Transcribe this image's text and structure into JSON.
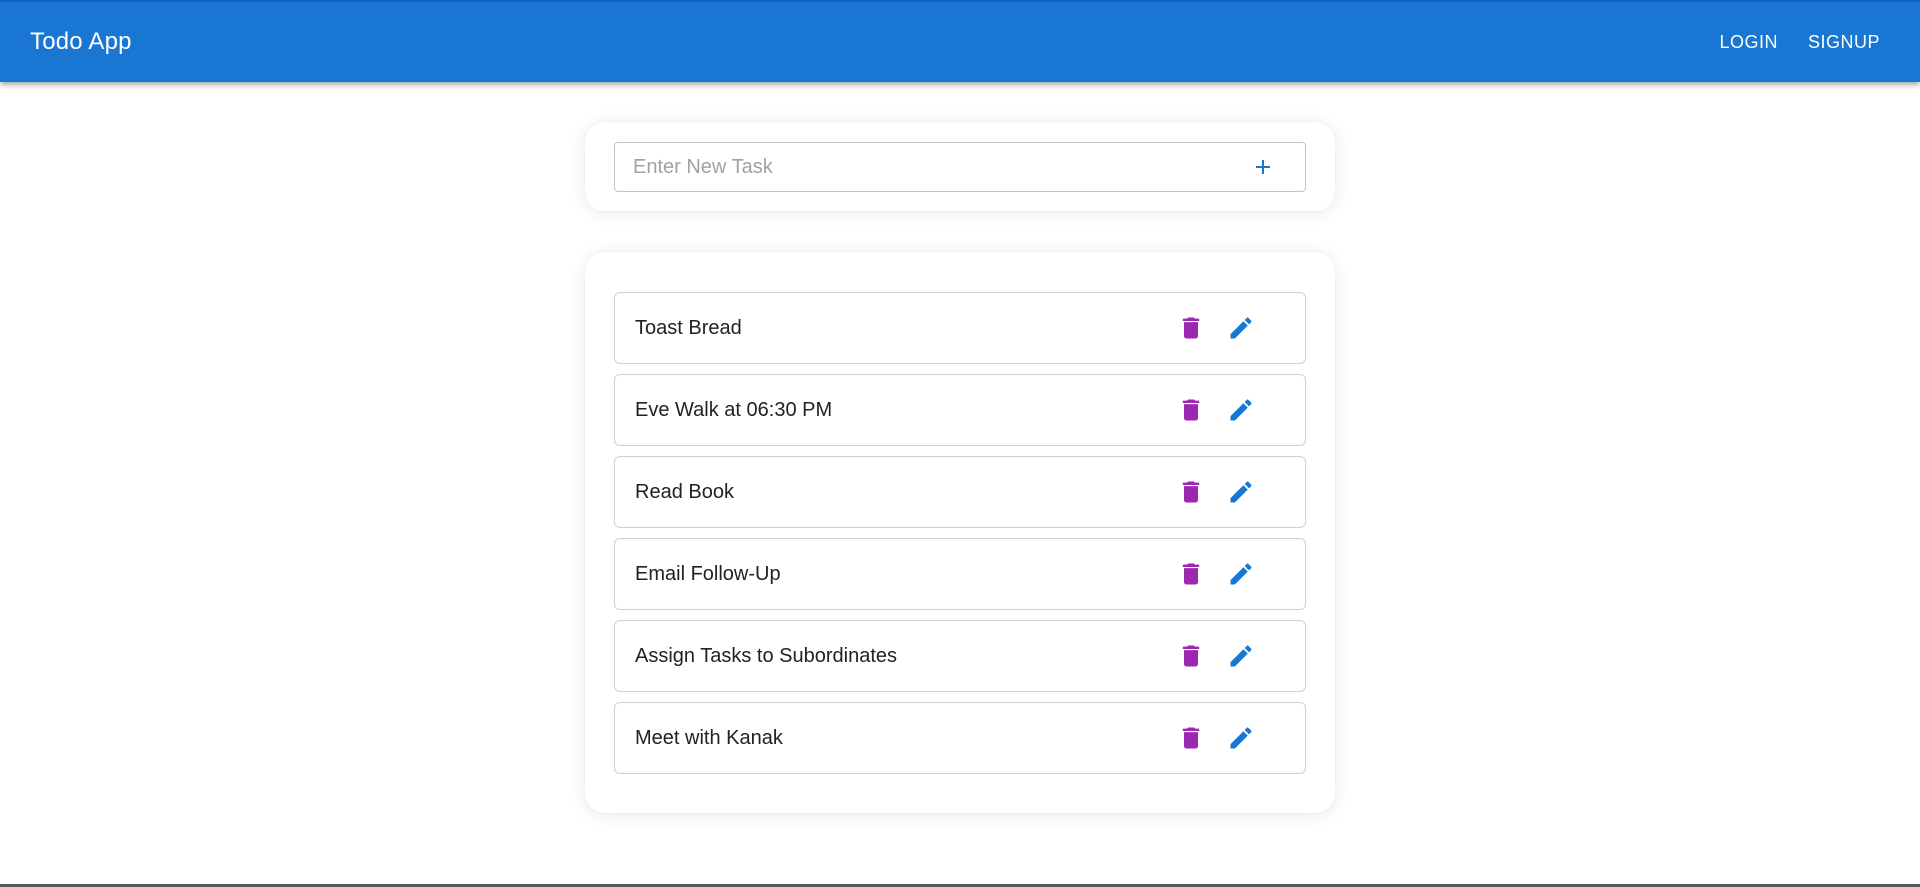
{
  "appbar": {
    "title": "Todo App",
    "login_label": "LOGIN",
    "signup_label": "SIGNUP"
  },
  "new_task": {
    "placeholder": "Enter New Task",
    "value": "",
    "add_icon": "plus-icon"
  },
  "tasks": [
    {
      "text": "Toast Bread"
    },
    {
      "text": "Eve Walk at 06:30 PM"
    },
    {
      "text": "Read Book"
    },
    {
      "text": "Email Follow-Up"
    },
    {
      "text": "Assign Tasks to Subordinates"
    },
    {
      "text": "Meet with Kanak"
    }
  ],
  "icons": {
    "delete": "trash-icon",
    "edit": "pencil-icon"
  },
  "colors": {
    "primary": "#1976d2",
    "delete": "#9c27b0",
    "edit": "#1976d2"
  }
}
